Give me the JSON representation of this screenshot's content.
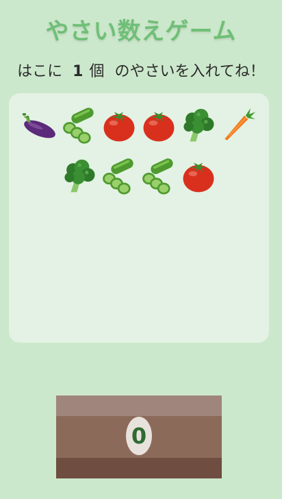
{
  "game": {
    "title": "やさい数えゲーム",
    "instruction_prefix": "はこに",
    "target_count": "1",
    "target_unit": "個",
    "instruction_suffix": "のやさいを入れてね！",
    "box_count": "0"
  },
  "vegetables": [
    {
      "type": "eggplant",
      "icon": "eggplant-icon"
    },
    {
      "type": "cucumber",
      "icon": "cucumber-icon"
    },
    {
      "type": "tomato",
      "icon": "tomato-icon"
    },
    {
      "type": "tomato",
      "icon": "tomato-icon"
    },
    {
      "type": "broccoli",
      "icon": "broccoli-icon"
    },
    {
      "type": "carrot",
      "icon": "carrot-icon"
    },
    {
      "type": "broccoli",
      "icon": "broccoli-icon"
    },
    {
      "type": "cucumber",
      "icon": "cucumber-icon"
    },
    {
      "type": "cucumber",
      "icon": "cucumber-icon"
    },
    {
      "type": "tomato",
      "icon": "tomato-icon"
    }
  ],
  "colors": {
    "background": "#cce8cc",
    "panel": "#e3f2e4",
    "title": "#6fbf76",
    "box": "#8c6a5a",
    "counter_text": "#2f6b33"
  }
}
